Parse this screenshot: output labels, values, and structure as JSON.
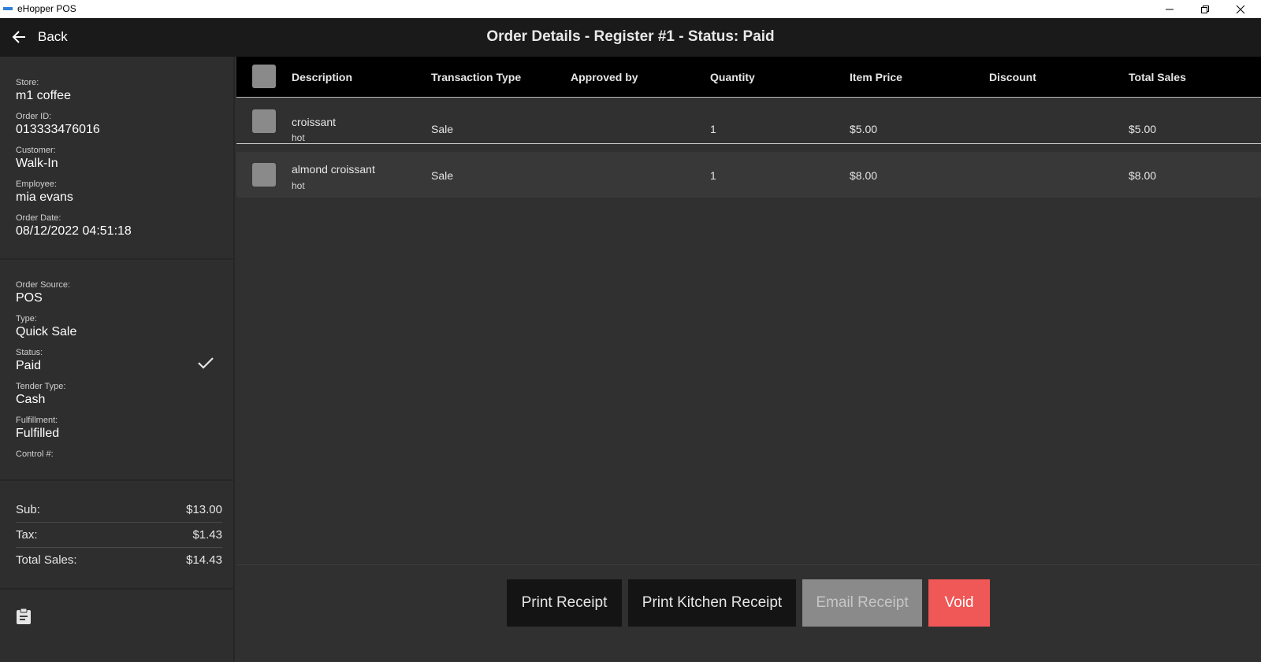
{
  "window": {
    "title": "eHopper POS"
  },
  "header": {
    "back_label": "Back",
    "title": "Order Details - Register #1 - Status: Paid"
  },
  "sidebar": {
    "store": {
      "label": "Store:",
      "value": "m1 coffee"
    },
    "order_id": {
      "label": "Order ID:",
      "value": "013333476016"
    },
    "customer": {
      "label": "Customer:",
      "value": "Walk-In"
    },
    "employee": {
      "label": "Employee:",
      "value": "mia evans"
    },
    "order_date": {
      "label": "Order Date:",
      "value": "08/12/2022 04:51:18"
    },
    "order_source": {
      "label": "Order Source:",
      "value": "POS"
    },
    "type": {
      "label": "Type:",
      "value": "Quick Sale"
    },
    "status": {
      "label": "Status:",
      "value": "Paid"
    },
    "tender_type": {
      "label": "Tender Type:",
      "value": "Cash"
    },
    "fulfillment": {
      "label": "Fulfillment:",
      "value": "Fulfilled"
    },
    "control": {
      "label": "Control #:"
    },
    "totals": {
      "sub": {
        "label": "Sub:",
        "value": "$13.00"
      },
      "tax": {
        "label": "Tax:",
        "value": "$1.43"
      },
      "total": {
        "label": "Total Sales:",
        "value": "$14.43"
      }
    }
  },
  "table": {
    "columns": [
      "Description",
      "Transaction Type",
      "Approved by",
      "Quantity",
      "Item Price",
      "Discount",
      "Total Sales"
    ],
    "rows": [
      {
        "description": "croissant",
        "modifier": "hot",
        "transaction_type": "Sale",
        "approved_by": "",
        "quantity": "1",
        "item_price": "$5.00",
        "discount": "",
        "total_sales": "$5.00"
      },
      {
        "description": "almond croissant",
        "modifier": "hot",
        "transaction_type": "Sale",
        "approved_by": "",
        "quantity": "1",
        "item_price": "$8.00",
        "discount": "",
        "total_sales": "$8.00"
      }
    ]
  },
  "actions": {
    "print_receipt": "Print Receipt",
    "print_kitchen_receipt": "Print Kitchen Receipt",
    "email_receipt": "Email Receipt",
    "void": "Void"
  },
  "colors": {
    "header_bg": "#1a1a1a",
    "void": "#f05757",
    "disabled": "#8a8a8a"
  }
}
